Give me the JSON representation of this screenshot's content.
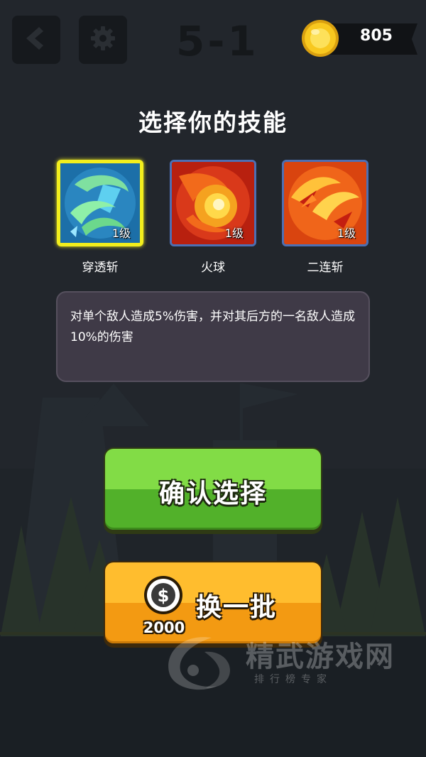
{
  "header": {
    "level": "5-1",
    "coins": "805",
    "back_icon": "back-arrow-icon",
    "settings_icon": "gear-icon",
    "coin_icon": "gold-coin-icon"
  },
  "title": "选择你的技能",
  "skills": [
    {
      "name": "穿透斩",
      "level": "1级",
      "selected": true,
      "icon": "piercing-slash-icon"
    },
    {
      "name": "火球",
      "level": "1级",
      "selected": false,
      "icon": "fireball-icon"
    },
    {
      "name": "二连斩",
      "level": "1级",
      "selected": false,
      "icon": "double-slash-icon"
    }
  ],
  "description": "对单个敌人造成5%伤害，并对其后方的一名敌人造成10%的伤害",
  "buttons": {
    "confirm": "确认选择",
    "refresh": "换一批",
    "refresh_cost": "2000"
  },
  "watermark": {
    "title": "精武游戏网",
    "subtitle": "排行榜专家"
  },
  "colors": {
    "background": "#22262c",
    "selected_border": "#f2ee1d",
    "confirm_green": "#6ac83a",
    "refresh_orange": "#f7a81c",
    "coin_gold": "#f5c21b"
  }
}
